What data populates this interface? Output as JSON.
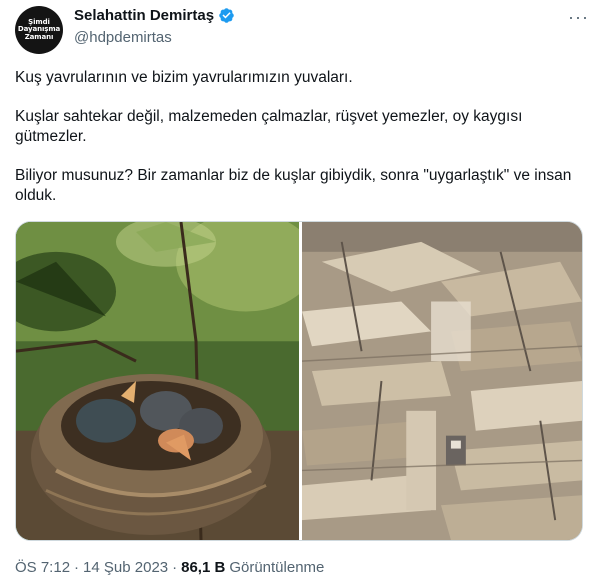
{
  "author": {
    "avatar_lines": [
      "Şimdi",
      "Dayanışma",
      "Zamanı"
    ],
    "display_name": "Selahattin Demirtaş",
    "handle": "@hdpdemirtas",
    "verified_color": "#1d9bf0"
  },
  "tweet": {
    "paragraphs": [
      "Kuş yavrularının ve bizim yavrularımızın yuvaları.",
      "Kuşlar sahtekar değil, malzemeden çalmazlar, rüşvet yemezler, oy kaygısı gütmezler.",
      "Biliyor musunuz? Bir zamanlar biz de kuşlar gibiydik, sonra \"uygarlaştık\" ve insan olduk."
    ],
    "time": "ÖS 7:12",
    "separator": "·",
    "date": "14 Şub 2023",
    "views_count": "86,1 B",
    "views_label": "Görüntülenme"
  },
  "icons": {
    "more": "more-icon",
    "verified": "verified-badge-icon"
  }
}
